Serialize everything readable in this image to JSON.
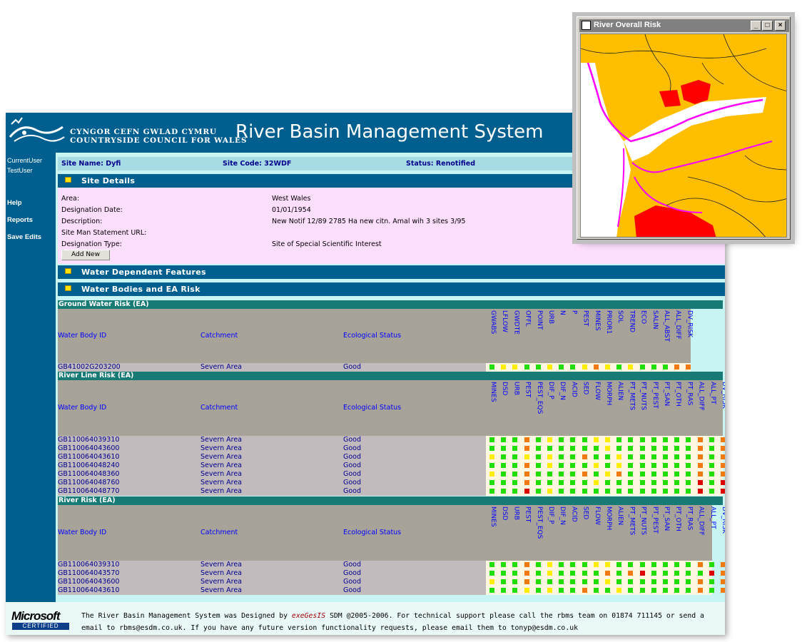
{
  "header": {
    "org_line1": "CYNGOR CEFN GWLAD CYMRU",
    "org_line2": "COUNTRYSIDE COUNCIL FOR WALES",
    "title": "River Basin Management System"
  },
  "sidebar": {
    "user_line1": "CurrentUser",
    "user_line2": "TestUser",
    "links": [
      "Help",
      "Reports",
      "Save Edits"
    ]
  },
  "site": {
    "name": "Site Name: Dyfi",
    "code": "Site Code: 32WDF",
    "status": "Status: Renotified"
  },
  "sections": {
    "site_details": "Site Details",
    "water_features": "Water Dependent Features",
    "water_bodies": "Water Bodies and EA Risk"
  },
  "details": [
    {
      "label": "Area:",
      "value": "West Wales"
    },
    {
      "label": "Designation Date:",
      "value": "01/01/1954"
    },
    {
      "label": "Description:",
      "value": "New Notif 12/89 2785 Ha new citn. Amal wih 3 sites 3/95"
    },
    {
      "label": "Site Man Statement URL:",
      "value": ""
    },
    {
      "label": "Designation Type:",
      "value": "Site of Special Scientific Interest"
    }
  ],
  "add_new": "Add New",
  "table_headers": {
    "id": "Water Body ID",
    "catchment": "Catchment",
    "status": "Ecological Status"
  },
  "risk_colors": {
    "G": "#22dd00",
    "Y": "#ffee00",
    "O": "#f07a10",
    "R": "#dd0000"
  },
  "groundwater": {
    "title": "Ground Water Risk (EA)",
    "columns": [
      "GWABS",
      "LFLOW",
      "GWDTE",
      "OFFL",
      "POINT",
      "URB",
      "N",
      "P",
      "PEST",
      "MINES",
      "PRIOR1",
      "SOL",
      "TREND",
      "ECO",
      "SALIN",
      "ALL_ABST",
      "ALL_DIFF",
      "DV_RISK"
    ],
    "rows": [
      {
        "id": "GB41002G203200",
        "catchment": "Severn Area",
        "status": "Good",
        "risk": "GYYGGYGGYOYGYGGGOO"
      }
    ]
  },
  "riverline": {
    "title": "River Line Risk (EA)",
    "columns": [
      "MINES",
      "DSD",
      "URB",
      "PEST",
      "PEST_EQS",
      "DIF_P",
      "DIF_N",
      "ACID",
      "SED",
      "FLOW",
      "MORPH",
      "ALIEN",
      "PT_METS",
      "PT_NUTS",
      "PT_PEST",
      "PT_SAN",
      "PT_OTH",
      "PT_RAS",
      "ALL_DIFF",
      "ALL_PT",
      "DV_RISK"
    ],
    "rows": [
      {
        "id": "GB110064039310",
        "catchment": "Severn Area",
        "status": "Good",
        "risk": "GGGOGYGGGYYGGGGGGGOGO"
      },
      {
        "id": "GB110064043600",
        "catchment": "Severn Area",
        "status": "Good",
        "risk": "GGGOGGGGGGYGGGGGGGOGO"
      },
      {
        "id": "GB110064043610",
        "catchment": "Severn Area",
        "status": "Good",
        "risk": "YGGYGYGGOGGYGGGGGGOGO"
      },
      {
        "id": "GB110064048240",
        "catchment": "Severn Area",
        "status": "Good",
        "risk": "GGGOGYGGGYGYGGGGGGOGO"
      },
      {
        "id": "GB110064048360",
        "catchment": "Severn Area",
        "status": "Good",
        "risk": "YGGOGGGGOGYOGGGGGGOGO"
      },
      {
        "id": "GB110064048760",
        "catchment": "Severn Area",
        "status": "Good",
        "risk": "GGGOGGGGGYGGGGGGGGRGR"
      },
      {
        "id": "GB110064048770",
        "catchment": "Severn Area",
        "status": "Good",
        "risk": "GGGRGYGGGGGGGGGGGGRGR"
      }
    ]
  },
  "river": {
    "title": "River Risk (EA)",
    "columns": [
      "MINES",
      "DSD",
      "URB",
      "PEST",
      "PEST_EQS",
      "DIF_P",
      "DIF_N",
      "ACID",
      "SED",
      "FLOW",
      "MORPH",
      "ALIEN",
      "PT_METS",
      "PT_NUTS",
      "PT_PEST",
      "PT_SAN",
      "PT_OTH",
      "PT_RAS",
      "ALL_DIFF",
      "ALL_PT",
      "DV_RISK"
    ],
    "rows": [
      {
        "id": "GB110064039310",
        "catchment": "Severn Area",
        "status": "Good",
        "risk": "GGGOGYGGGYYGGGGGGGOGO"
      },
      {
        "id": "GB110064043570",
        "catchment": "Severn Area",
        "status": "Good",
        "risk": "GGGOGYGGGGOGORGGGGGRO"
      },
      {
        "id": "GB110064043600",
        "catchment": "Severn Area",
        "status": "Good",
        "risk": "YGGOGGGGGGYGGGGGGGOGO"
      },
      {
        "id": "GB110064043610",
        "catchment": "Severn Area",
        "status": "Good",
        "risk": "GGGYGYGGOGGYGGGGGGOGO"
      }
    ]
  },
  "footer": {
    "logo": "Microsoft",
    "certified": "CERTIFIED",
    "line1_a": "The River Basin Management System was Designed by ",
    "line1_brand": "exeGesIS",
    "line1_b": " SDM @2005-2006. For technical support please call the rbms team on 01874 711145 or send a",
    "line2": "email to rbms@esdm.co.uk. If you have any future version functionality requests, please email them to tonyp@esdm.co.uk"
  },
  "map_window": {
    "title": "River Overall Risk",
    "colors": {
      "land": "#ffbe00",
      "high": "#ff0000",
      "boundary": "#ff00ff",
      "sea": "#ffffff"
    }
  }
}
